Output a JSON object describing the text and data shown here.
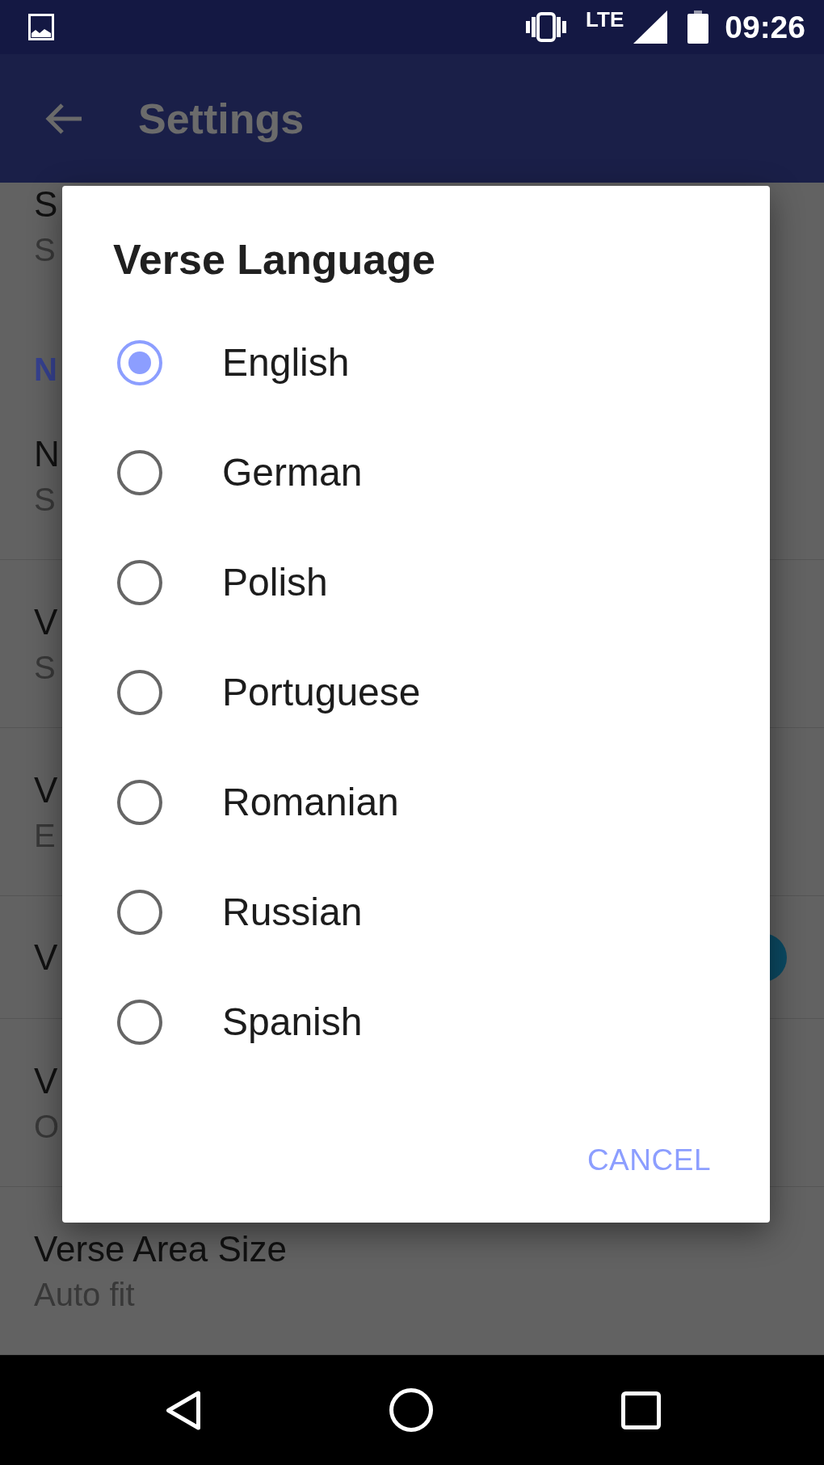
{
  "status_bar": {
    "network": "LTE",
    "time": "09:26"
  },
  "app_bar": {
    "title": "Settings"
  },
  "settings_list": [
    {
      "kind": "item",
      "title": "S",
      "summary": "S"
    },
    {
      "kind": "category",
      "title": "N"
    },
    {
      "kind": "item",
      "title": "N",
      "summary": "S"
    },
    {
      "kind": "item",
      "title": "V",
      "summary": "S"
    },
    {
      "kind": "item",
      "title": "V",
      "summary": "E"
    },
    {
      "kind": "swatch",
      "title": "V",
      "color": "#0b4a63"
    },
    {
      "kind": "item",
      "title": "V",
      "summary": "O"
    },
    {
      "kind": "item",
      "title": "Verse Area Size",
      "summary": "Auto fit"
    }
  ],
  "dialog": {
    "title": "Verse Language",
    "options": [
      {
        "label": "English",
        "selected": true
      },
      {
        "label": "German",
        "selected": false
      },
      {
        "label": "Polish",
        "selected": false
      },
      {
        "label": "Portuguese",
        "selected": false
      },
      {
        "label": "Romanian",
        "selected": false
      },
      {
        "label": "Russian",
        "selected": false
      },
      {
        "label": "Spanish",
        "selected": false
      }
    ],
    "buttons": [
      "CANCEL"
    ]
  }
}
